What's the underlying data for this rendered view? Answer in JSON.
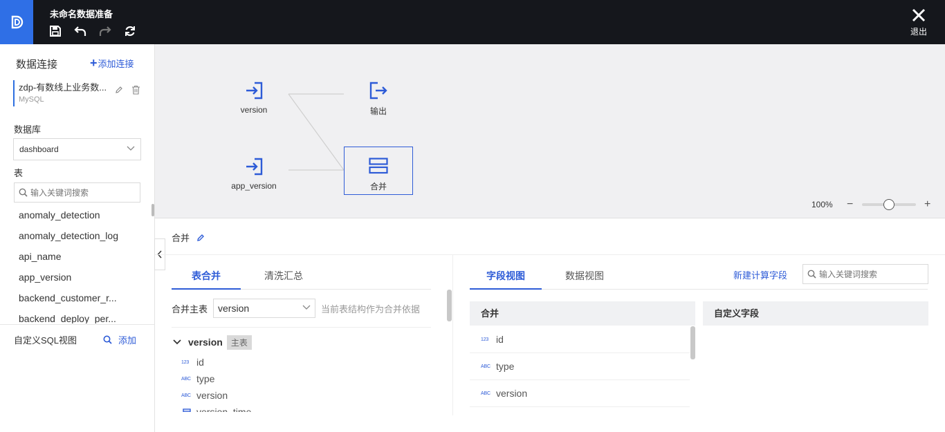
{
  "header": {
    "title": "未命名数据准备",
    "exit_label": "退出",
    "colors": {
      "bg": "#15171c",
      "logo_bg": "#2f6fe6"
    }
  },
  "sidebar": {
    "title": "数据连接",
    "add_connection": "添加连接",
    "connection": {
      "name": "zdp-有数线上业务数...",
      "type": "MySQL"
    },
    "database_label": "数据库",
    "database_value": "dashboard",
    "table_label": "表",
    "search_placeholder": "输入关键词搜索",
    "tables": [
      "anomaly_detection",
      "anomaly_detection_log",
      "api_name",
      "app_version",
      "backend_customer_r...",
      "backend_deploy_per..."
    ],
    "sql_label": "自定义SQL视图",
    "sql_add": "添加"
  },
  "canvas": {
    "nodes": [
      {
        "label": "version",
        "icon": "input-icon"
      },
      {
        "label": "输出",
        "icon": "output-icon"
      },
      {
        "label": "app_version",
        "icon": "input-icon"
      },
      {
        "label": "合并",
        "icon": "merge-icon",
        "selected": true
      }
    ],
    "zoom": "100%",
    "zoom_level": 0.5
  },
  "panel": {
    "title": "合并",
    "left_tabs": [
      {
        "label": "表合并",
        "active": true
      },
      {
        "label": "清洗汇总",
        "active": false
      }
    ],
    "merge_main_label": "合并主表",
    "merge_main_value": "version",
    "merge_hint": "当前表结构作为合并依据",
    "tree": {
      "name": "version",
      "badge": "主表",
      "fields": [
        {
          "type": "123",
          "name": "id"
        },
        {
          "type": "ABC",
          "name": "type"
        },
        {
          "type": "ABC",
          "name": "version"
        },
        {
          "type": "date",
          "name": "version_time"
        }
      ]
    },
    "right_tabs": [
      {
        "label": "字段视图",
        "active": true
      },
      {
        "label": "数据视图",
        "active": false
      }
    ],
    "new_field": "新建计算字段",
    "right_search_placeholder": "输入关键词搜索",
    "merge_col_header": "合并",
    "custom_col_header": "自定义字段",
    "merge_fields": [
      {
        "type": "123",
        "name": "id"
      },
      {
        "type": "ABC",
        "name": "type"
      },
      {
        "type": "ABC",
        "name": "version"
      }
    ],
    "accent": "#2d5bd7"
  }
}
